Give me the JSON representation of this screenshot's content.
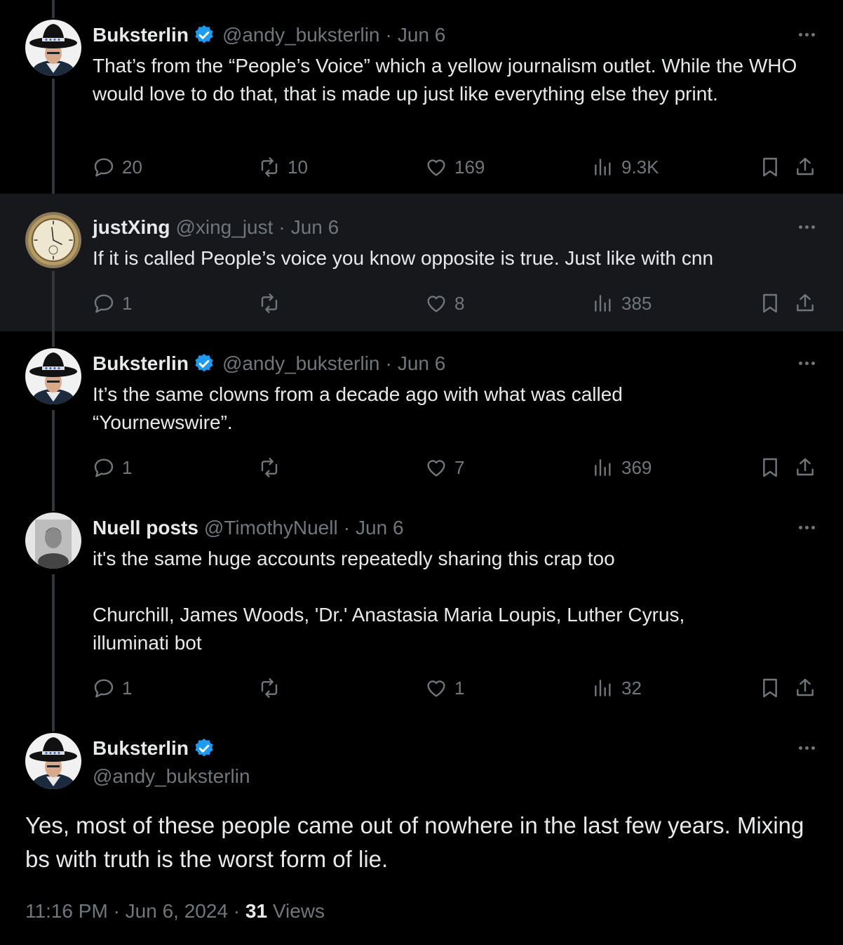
{
  "colors": {
    "background": "#000000",
    "highlight": "#16181c",
    "text": "#e7e9ea",
    "muted": "#71767b",
    "verified": "#1d9bf0"
  },
  "replies": [
    {
      "name": "Buksterlin",
      "verified": true,
      "handle": "@andy_buksterlin",
      "sep": "·",
      "time": "Jun 6",
      "text": "That’s from the “People’s Voice” which a yellow journalism outlet. While the WHO would love to do that, that is made up just like everything else they print.",
      "stats": {
        "replies": "20",
        "reposts": "10",
        "likes": "169",
        "views": "9.3K"
      }
    },
    {
      "name": "justXing",
      "verified": false,
      "handle": "@xing_just",
      "sep": "·",
      "time": "Jun 6",
      "text": "If it is called People’s voice you know opposite is true.  Just like with cnn",
      "stats": {
        "replies": "1",
        "reposts": "",
        "likes": "8",
        "views": "385"
      }
    },
    {
      "name": "Buksterlin",
      "verified": true,
      "handle": "@andy_buksterlin",
      "sep": "·",
      "time": "Jun 6",
      "text": "It’s the same clowns from a decade ago with what was called “Yournewswire”.",
      "stats": {
        "replies": "1",
        "reposts": "",
        "likes": "7",
        "views": "369"
      }
    },
    {
      "name": "Nuell posts",
      "verified": false,
      "handle": "@TimothyNuell",
      "sep": "·",
      "time": "Jun 6",
      "text_line1": "it's the same huge accounts repeatedly sharing this crap too",
      "text_line2": "Churchill, James Woods, 'Dr.' Anastasia Maria Loupis, Luther Cyrus, illuminati bot",
      "stats": {
        "replies": "1",
        "reposts": "",
        "likes": "1",
        "views": "32"
      }
    }
  ],
  "main_post": {
    "name": "Buksterlin",
    "verified": true,
    "handle": "@andy_buksterlin",
    "text": "Yes, most of these people came out of nowhere in the last few years. Mixing bs with truth is the worst form of lie.",
    "time": "11:16 PM",
    "date": "Jun 6, 2024",
    "sep": "·",
    "views_count": "31",
    "views_label": "Views"
  },
  "icons": {
    "reply": "reply-icon",
    "repost": "repost-icon",
    "like": "heart-icon",
    "views": "views-icon",
    "bookmark": "bookmark-icon",
    "share": "share-icon",
    "more": "more-icon",
    "verified": "verified-badge-icon"
  }
}
